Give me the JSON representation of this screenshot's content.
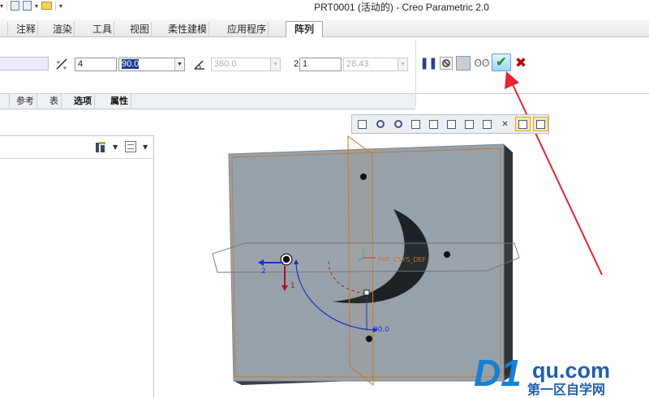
{
  "window": {
    "title": "PRT0001 (活动的) - Creo Parametric 2.0"
  },
  "ribbon_tabs": [
    {
      "label": "注释"
    },
    {
      "label": "渲染"
    },
    {
      "label": "工具"
    },
    {
      "label": "视图"
    },
    {
      "label": "柔性建模"
    },
    {
      "label": "应用程序"
    },
    {
      "label": "阵列",
      "active": true
    }
  ],
  "pattern_panel": {
    "first_count": "4",
    "first_angle": "90.0",
    "angular_extent": "360.0",
    "second_label": "2",
    "second_count": "1",
    "second_spacing": "28.43"
  },
  "sub_tabs": [
    {
      "label": "参考"
    },
    {
      "label": "表"
    },
    {
      "label": "选项"
    },
    {
      "label": "属性"
    }
  ],
  "controls": {
    "pause_icon": "pause-icon",
    "no_preview_icon": "stop-icon",
    "verify_icon": "preview-icon",
    "glasses_icon": "glasses-icon",
    "ok_icon": "check-icon",
    "cancel_icon": "close-icon",
    "ok_color": "#138a2a",
    "cancel_color": "#b30c0c"
  },
  "graphics": {
    "csys_label": "PRT_CSYS_DEF",
    "dim_angle": "90.0",
    "dir1_label": "1",
    "dir2_label": "2"
  },
  "watermark": {
    "logo_big": "D1",
    "logo_domain": "qu.com",
    "logo_sub": "第一区自学网"
  },
  "colors": {
    "part_face": "#97a1aa",
    "part_side": "#2e3338",
    "datum_plane": "#c07a3a",
    "accent_blue": "#1832c8",
    "arrow_red": "#e8232f"
  }
}
